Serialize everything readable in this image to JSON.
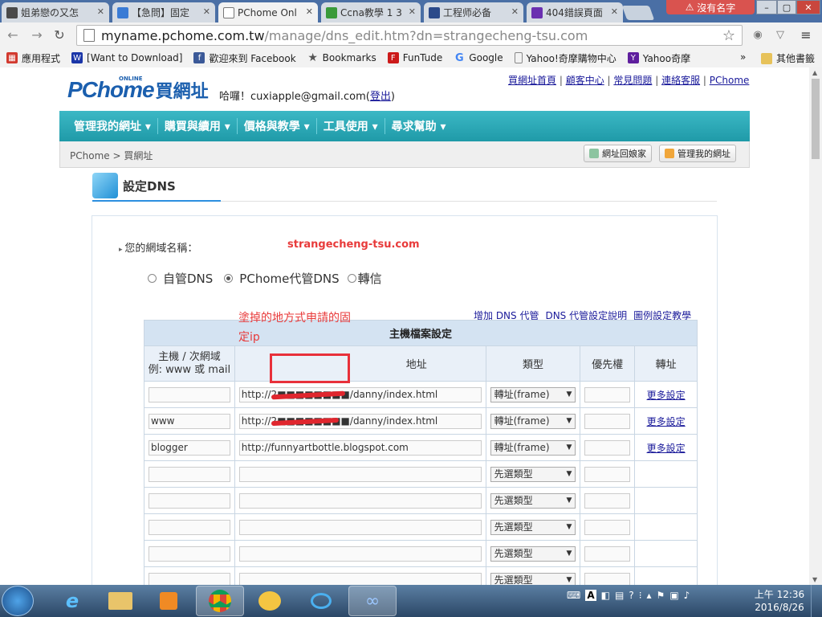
{
  "browser": {
    "tabs": [
      {
        "title": "姐弟戀の又怎",
        "icon_color": "#4a4a4a",
        "left": 0
      },
      {
        "title": "【急問】固定",
        "icon_color": "#3a7bd5"
      },
      {
        "title": "PChome Onl",
        "icon_color": "#ffffff"
      },
      {
        "title": "Ccna教學 1 3",
        "icon_color": "#3a9a3a"
      },
      {
        "title": "工程师必备",
        "icon_color": "#2b4a8a"
      },
      {
        "title": "404錯誤頁面",
        "icon_color": "#6a2fb0"
      }
    ],
    "user_badge": "沒有名字",
    "window_buttons": [
      "–",
      "▢",
      "✕"
    ],
    "url_host": "myname.pchome.com.tw",
    "url_path": "/manage/dns_edit.htm?dn=strangecheng-tsu.com",
    "bookmarks": [
      {
        "label": "應用程式",
        "icon": "apps-grid-icon",
        "color": "#d23a2f"
      },
      {
        "label": "[Want to Download]",
        "icon": "w-icon",
        "color": "#1b36a8"
      },
      {
        "label": "歡迎來到 Facebook",
        "icon": "facebook-icon",
        "color": "#3b5998"
      },
      {
        "label": "Bookmarks",
        "icon": "star-icon",
        "color": "#555555"
      },
      {
        "label": "FunTude",
        "icon": "f-icon",
        "color": "#cc1a1a"
      },
      {
        "label": "Google",
        "icon": "google-icon",
        "color": "#4285f4"
      },
      {
        "label": "Yahoo!奇摩購物中心",
        "icon": "page-icon",
        "color": "#888888"
      },
      {
        "label": "Yahoo奇摩",
        "icon": "yahoo-icon",
        "color": "#5f1f9e"
      }
    ],
    "bookmarks_overflow": "»",
    "other_bookmarks": "其他書籤"
  },
  "site": {
    "logo_main": "PChome",
    "logo_online": "ONLINE",
    "logo_name": "買網址",
    "greeting_prefix": "哈囉！cuxiapple@gmail.com(",
    "logout": "登出",
    "greeting_suffix": ")",
    "top_links": [
      "買網址首頁",
      "顧客中心",
      "常見問題",
      "連絡客服",
      "PChome"
    ],
    "nav": [
      "管理我的網址 ▾",
      "購買與續用 ▾",
      "價格與教學 ▾",
      "工具使用 ▾",
      "尋求幫助 ▾"
    ],
    "breadcrumb": "PChome > 買網址",
    "btn_home": "網址回娘家",
    "btn_manage": "管理我的網址",
    "section_title": "設定DNS"
  },
  "dns": {
    "domain_label": "您的網域名稱：",
    "domain_value": "strangecheng-tsu.com",
    "radio_self": "自管DNS",
    "radio_pchome": "PChome代管DNS",
    "radio_forward": "轉信",
    "note": "塗掉的地方式申請的固定ip",
    "link_add": "增加 DNS 代管",
    "link_help": "DNS 代管設定說明",
    "link_example": "圖例設定教學",
    "table_caption": "主機檔案設定",
    "col_host_1": "主機 / 次網域",
    "col_host_2": "例: www 或 mail",
    "col_addr": "地址",
    "col_type": "類型",
    "col_priority": "優先權",
    "col_forward": "轉址",
    "rows": [
      {
        "host": "",
        "addr": "http://2■■■■■■■■/danny/index.html",
        "type": "轉址(frame)",
        "more": "更多設定"
      },
      {
        "host": "www",
        "addr": "http://2■■■■■■■■/danny/index.html",
        "type": "轉址(frame)",
        "more": "更多設定"
      },
      {
        "host": "blogger",
        "addr": "http://funnyartbottle.blogspot.com",
        "type": "轉址(frame)",
        "more": "更多設定"
      },
      {
        "host": "",
        "addr": "",
        "type": "先選類型",
        "more": ""
      },
      {
        "host": "",
        "addr": "",
        "type": "先選類型",
        "more": ""
      },
      {
        "host": "",
        "addr": "",
        "type": "先選類型",
        "more": ""
      },
      {
        "host": "",
        "addr": "",
        "type": "先選類型",
        "more": ""
      },
      {
        "host": "",
        "addr": "",
        "type": "先選類型",
        "more": ""
      }
    ]
  },
  "taskbar": {
    "ime": "A",
    "clock_time": "上午 12:36",
    "clock_date": "2016/8/26"
  }
}
